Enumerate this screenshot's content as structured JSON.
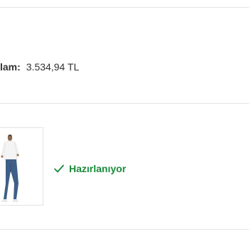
{
  "order": {
    "total_label": "lam:",
    "total_value": "3.534,94 TL"
  },
  "shipment": {
    "status_label": "Hazırlanıyor",
    "status_color": "#1a8a3a",
    "status_icon": "check-icon"
  }
}
